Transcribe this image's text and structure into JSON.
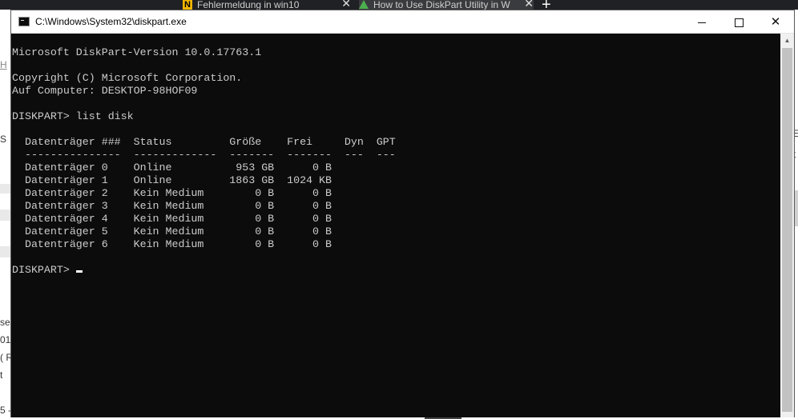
{
  "browser": {
    "tabs": [
      {
        "label": "Fehlermeldung in win10",
        "icon": "norton-icon"
      },
      {
        "label": "How to Use DiskPart Utility in W",
        "icon": "triangle-icon"
      }
    ],
    "new_tab": "+",
    "close_glyph": "✕",
    "left_fragments": [
      "H",
      "S",
      "se:",
      "01",
      "( R",
      "t",
      "5 -"
    ],
    "right_fragments": [
      "E",
      "t"
    ]
  },
  "window": {
    "title": "C:\\Windows\\System32\\diskpart.exe",
    "controls": {
      "close": "✕"
    }
  },
  "console": {
    "lines": [
      "Microsoft DiskPart-Version 10.0.17763.1",
      "",
      "Copyright (C) Microsoft Corporation.",
      "Auf Computer: DESKTOP-98HOF09",
      "",
      "DISKPART> list disk",
      "",
      "  Datenträger ###  Status         Größe    Frei     Dyn  GPT",
      "  ---------------  -------------  -------  -------  ---  ---",
      "  Datenträger 0    Online          953 GB      0 B",
      "  Datenträger 1    Online         1863 GB  1024 KB",
      "  Datenträger 2    Kein Medium        0 B      0 B",
      "  Datenträger 3    Kein Medium        0 B      0 B",
      "  Datenträger 4    Kein Medium        0 B      0 B",
      "  Datenträger 5    Kein Medium        0 B      0 B",
      "  Datenträger 6    Kein Medium        0 B      0 B",
      ""
    ],
    "prompt": "DISKPART>"
  }
}
